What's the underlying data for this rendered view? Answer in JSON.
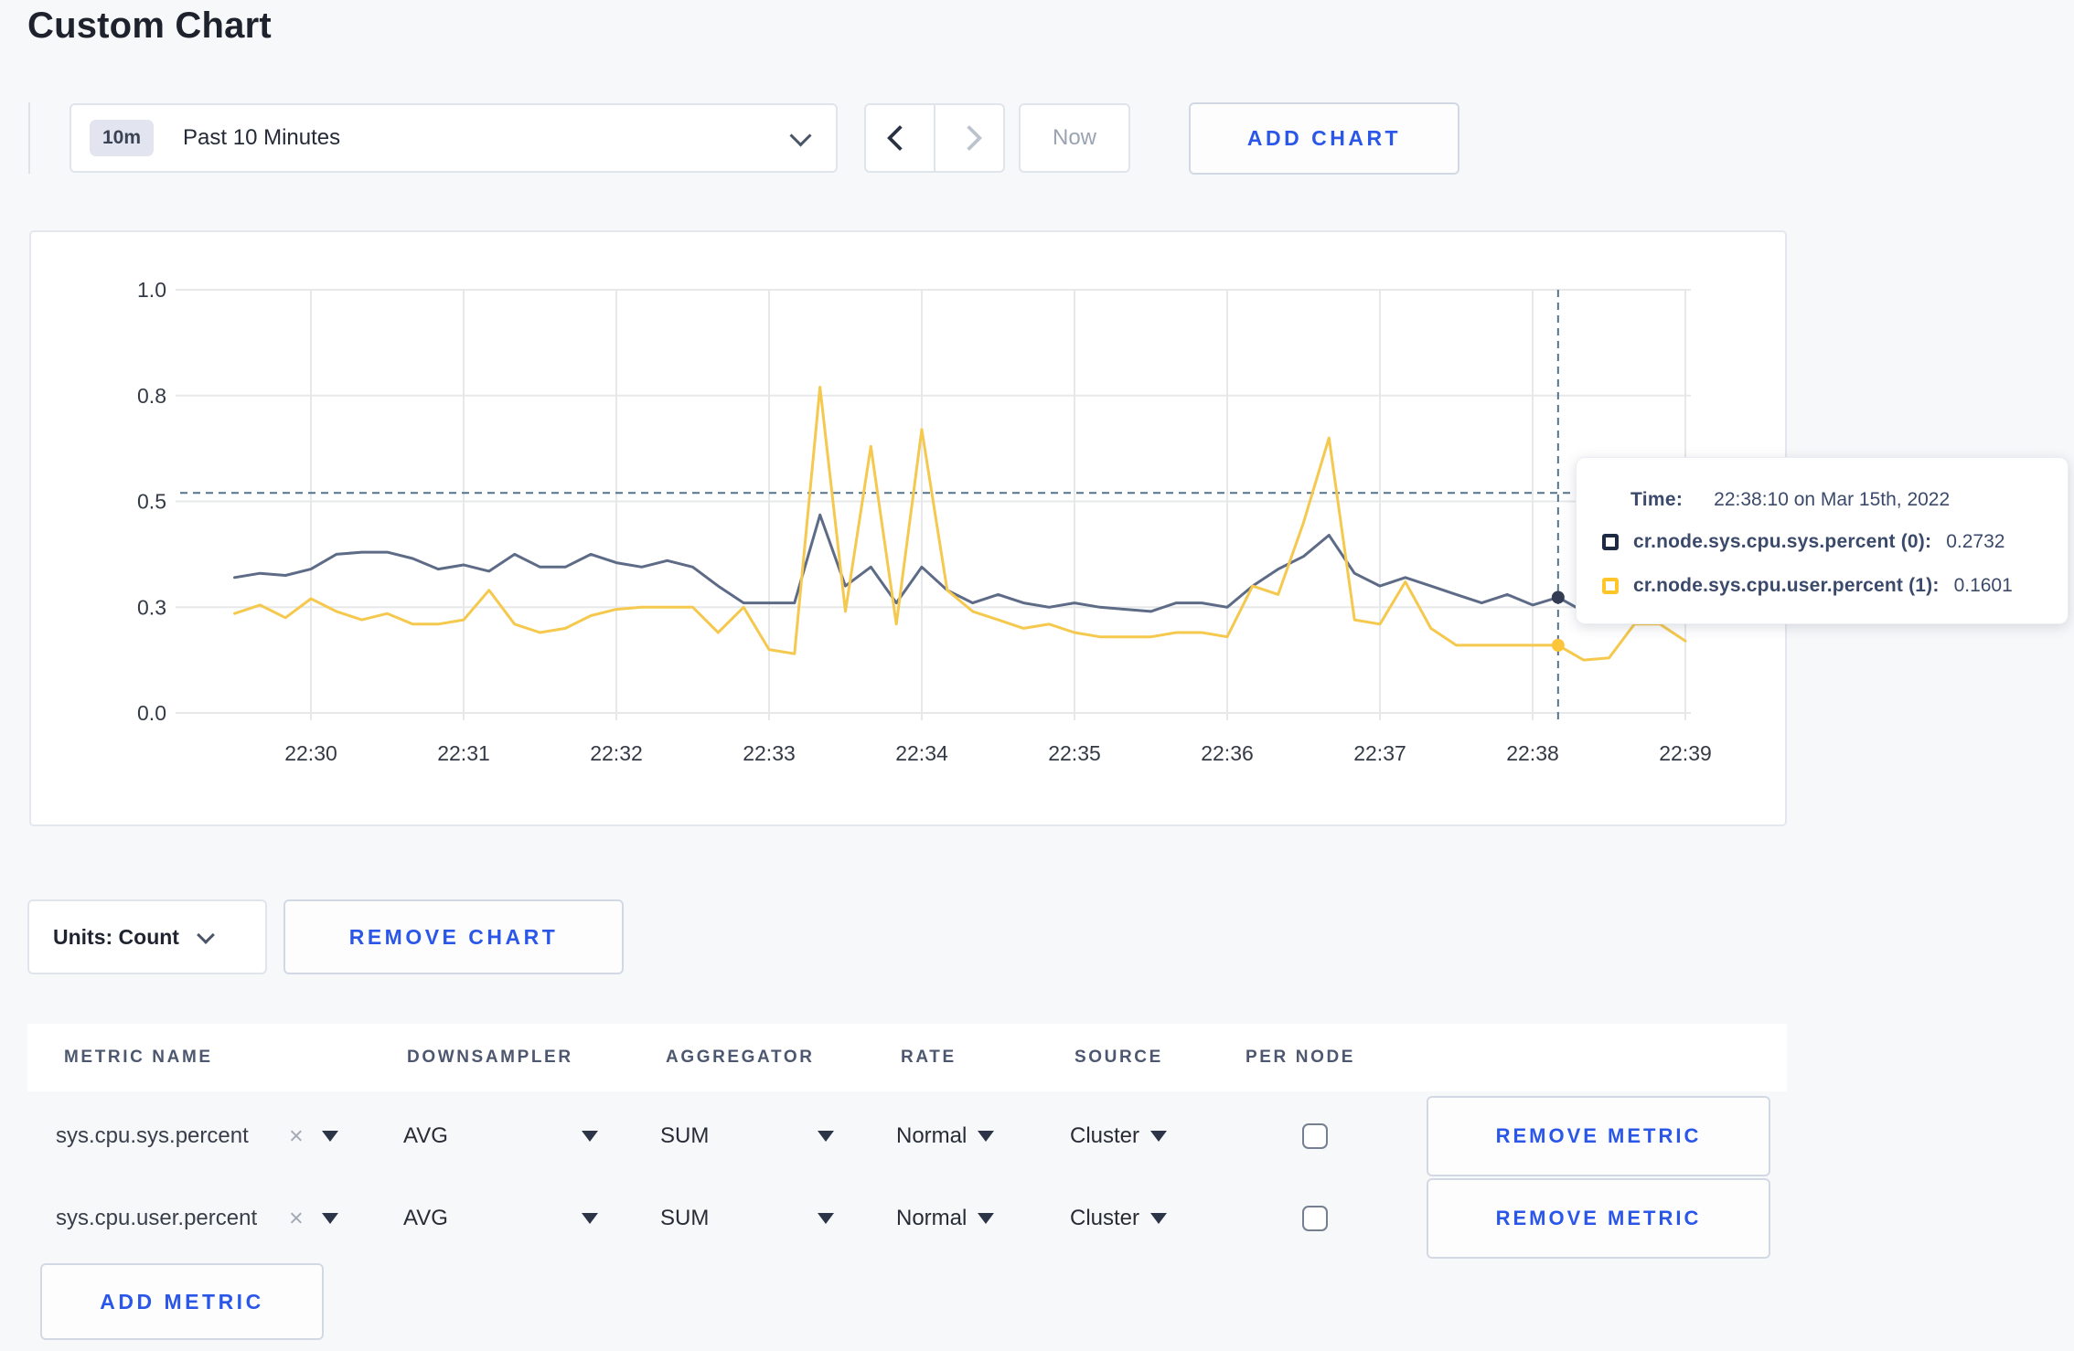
{
  "page": {
    "title": "Custom Chart"
  },
  "toolbar": {
    "time_window_badge": "10m",
    "time_window_label": "Past 10 Minutes",
    "now_label": "Now",
    "add_chart_label": "ADD CHART"
  },
  "chart_data": {
    "type": "line",
    "title": "",
    "xlabel": "",
    "ylabel": "",
    "grid": true,
    "x_axis": {
      "tick_labels": [
        "22:30",
        "22:31",
        "22:32",
        "22:33",
        "22:34",
        "22:35",
        "22:36",
        "22:37",
        "22:38",
        "22:39"
      ],
      "start_time": "22:29:30",
      "interval_seconds": 10
    },
    "y_axis": {
      "tick_labels": [
        "0.0",
        "0.3",
        "0.5",
        "0.8",
        "1.0"
      ],
      "tick_values": [
        0,
        0.25,
        0.5,
        0.75,
        1.0
      ],
      "range": [
        0,
        1
      ]
    },
    "series": [
      {
        "name": "cr.node.sys.cpu.sys.percent (0)",
        "color": "#5e6b87",
        "dot_color": "#333c54",
        "values": [
          0.32,
          0.33,
          0.325,
          0.34,
          0.375,
          0.38,
          0.38,
          0.365,
          0.34,
          0.35,
          0.335,
          0.375,
          0.345,
          0.345,
          0.375,
          0.355,
          0.345,
          0.36,
          0.345,
          0.3,
          0.26,
          0.26,
          0.26,
          0.468,
          0.3,
          0.345,
          0.26,
          0.345,
          0.29,
          0.26,
          0.28,
          0.26,
          0.25,
          0.26,
          0.25,
          0.245,
          0.24,
          0.26,
          0.26,
          0.25,
          0.3,
          0.34,
          0.37,
          0.42,
          0.33,
          0.3,
          0.32,
          0.3,
          0.28,
          0.26,
          0.28,
          0.255,
          0.2732,
          0.24,
          0.26,
          0.27,
          0.26,
          0.27
        ]
      },
      {
        "name": "cr.node.sys.cpu.user.percent (1)",
        "color": "#f5c84e",
        "dot_color": "#fdc53a",
        "values": [
          0.235,
          0.255,
          0.225,
          0.27,
          0.24,
          0.22,
          0.235,
          0.21,
          0.21,
          0.22,
          0.29,
          0.21,
          0.19,
          0.2,
          0.23,
          0.245,
          0.25,
          0.25,
          0.25,
          0.19,
          0.25,
          0.15,
          0.14,
          0.77,
          0.24,
          0.63,
          0.21,
          0.67,
          0.29,
          0.24,
          0.22,
          0.2,
          0.21,
          0.19,
          0.18,
          0.18,
          0.18,
          0.19,
          0.19,
          0.18,
          0.3,
          0.28,
          0.45,
          0.65,
          0.22,
          0.21,
          0.31,
          0.2,
          0.16,
          0.16,
          0.16,
          0.16,
          0.1601,
          0.125,
          0.13,
          0.21,
          0.21,
          0.17
        ]
      }
    ],
    "crosshair": {
      "time": "22:38:10",
      "index": 52,
      "hline_value": 0.52
    },
    "tooltip": {
      "time_label": "Time:",
      "time_value": "22:38:10 on Mar 15th, 2022",
      "rows": [
        {
          "name": "cr.node.sys.cpu.sys.percent (0):",
          "value": "0.2732",
          "color": "#1e2a44"
        },
        {
          "name": "cr.node.sys.cpu.user.percent (1):",
          "value": "0.1601",
          "color": "#ffc529"
        }
      ]
    }
  },
  "units_bar": {
    "units_label": "Units: Count",
    "remove_chart_label": "REMOVE CHART"
  },
  "metrics_table": {
    "headers": [
      "METRIC NAME",
      "DOWNSAMPLER",
      "AGGREGATOR",
      "RATE",
      "SOURCE",
      "PER NODE"
    ],
    "icons": {
      "clear": "×"
    },
    "rows": [
      {
        "metric_name": "sys.cpu.sys.percent",
        "downsampler": "AVG",
        "aggregator": "SUM",
        "rate": "Normal",
        "source": "Cluster",
        "per_node_checked": false,
        "remove_label": "REMOVE METRIC"
      },
      {
        "metric_name": "sys.cpu.user.percent",
        "downsampler": "AVG",
        "aggregator": "SUM",
        "rate": "Normal",
        "source": "Cluster",
        "per_node_checked": false,
        "remove_label": "REMOVE METRIC"
      }
    ],
    "add_metric_label": "ADD METRIC"
  },
  "colors": {
    "accent_blue": "#2b57e8",
    "series_sys": "#5e6b87",
    "series_user": "#f5c84e",
    "crosshair": "#54748e",
    "page_background": "#f7f8fa"
  }
}
